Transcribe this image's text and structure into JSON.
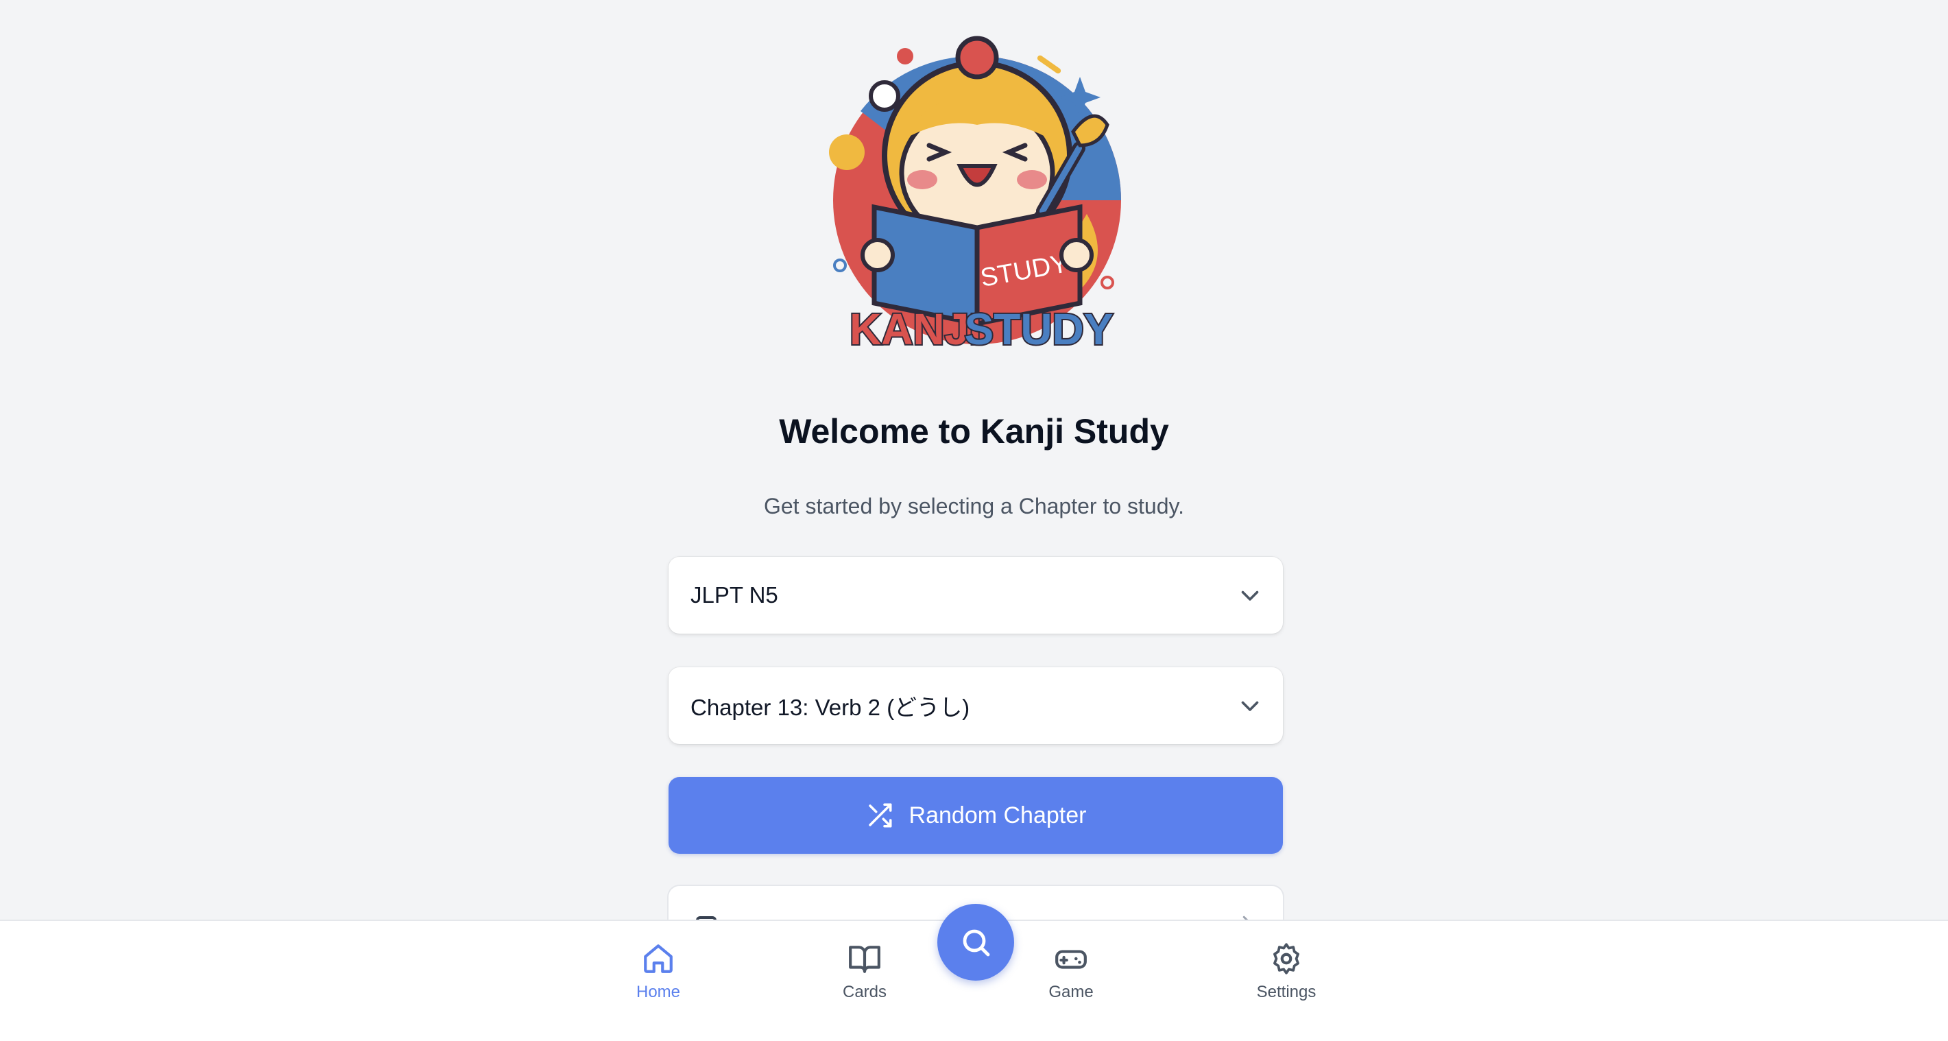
{
  "logo": {
    "book_text": "STUDY",
    "wordmark_part1": "KANJI",
    "wordmark_part2": "STUDY"
  },
  "main": {
    "title": "Welcome to Kanji Study",
    "subtitle": "Get started by selecting a Chapter to study.",
    "level_select": {
      "value": "JLPT N5"
    },
    "chapter_select": {
      "value": "Chapter 13: Verb 2 (どうし)"
    },
    "random_button": {
      "label": "Random Chapter",
      "icon": "shuffle-icon"
    }
  },
  "bottom_nav": {
    "items": [
      {
        "label": "Home",
        "icon": "home-icon",
        "active": true
      },
      {
        "label": "Cards",
        "icon": "book-open-icon",
        "active": false
      },
      {
        "label": "Game",
        "icon": "gamepad-icon",
        "active": false
      },
      {
        "label": "Settings",
        "icon": "gear-icon",
        "active": false
      }
    ],
    "fab_icon": "search-icon"
  },
  "colors": {
    "accent": "#5b80ed",
    "background": "#f3f4f6",
    "logo_red": "#d9534f",
    "logo_blue": "#4a7fc1",
    "logo_yellow": "#f0b940"
  }
}
